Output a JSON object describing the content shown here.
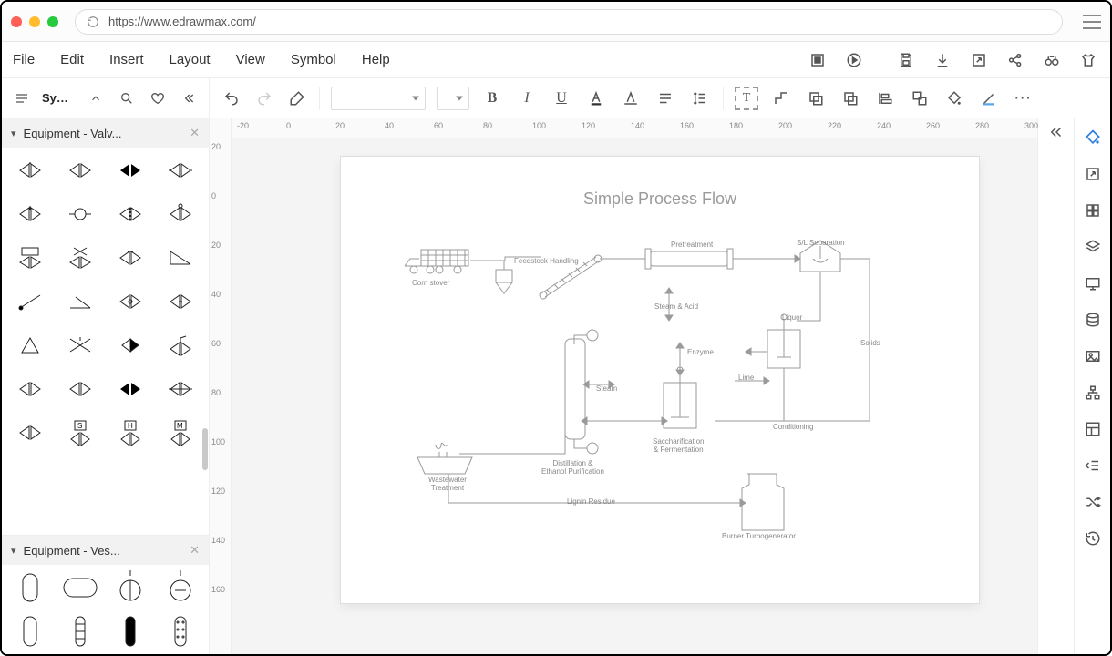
{
  "browser": {
    "url": "https://www.edrawmax.com/"
  },
  "menu": {
    "items": [
      "File",
      "Edit",
      "Insert",
      "Layout",
      "View",
      "Symbol",
      "Help"
    ]
  },
  "menuRightIcons": [
    "select-screen-icon",
    "play-icon",
    "save-icon",
    "download-icon",
    "export-icon",
    "share-icon",
    "binoculars-icon",
    "tshirt-icon"
  ],
  "sidebar": {
    "title": "Symbol...",
    "panel1": {
      "title": "Equipment - Valv..."
    },
    "panel2": {
      "title": "Equipment - Ves..."
    }
  },
  "toolbar": {
    "fontSelect": "",
    "sizeSelect": ""
  },
  "rulerH": [
    "-20",
    "0",
    "20",
    "40",
    "60",
    "80",
    "100",
    "120",
    "140",
    "160",
    "180",
    "200",
    "220",
    "240",
    "260",
    "280",
    "300"
  ],
  "rulerV": [
    "20",
    "0",
    "20",
    "40",
    "60",
    "80",
    "100",
    "120",
    "140",
    "160"
  ],
  "canvas": {
    "title": "Simple Process Flow",
    "labels": {
      "cornStover": "Corn stover",
      "feedstockHandling": "Feedstock Handling",
      "pretreatment": "Pretreatment",
      "slSeparation": "S/L Separation",
      "steamAcid": "Steam & Acid",
      "liquor": "Liquor",
      "solids": "Solids",
      "enzyme": "Enzyme",
      "lime": "Lime",
      "conditioning": "Conditioning",
      "steam": "Steam",
      "distillation": "Distillation &\nEthanol Purification",
      "saccharification": "Saccharification\n& Fermentation",
      "wastewater": "Wastewater\nTreatment",
      "ligninResidue": "Lignin Residue",
      "burner": "Burner Turbogenerator"
    }
  },
  "rightRailIcons": [
    "theme-icon",
    "export-panel-icon",
    "grid-icon",
    "layers-icon",
    "presentation-icon",
    "data-icon",
    "image-icon",
    "org-icon",
    "layout-icon",
    "indent-icon",
    "shuffle-icon",
    "history-icon"
  ]
}
